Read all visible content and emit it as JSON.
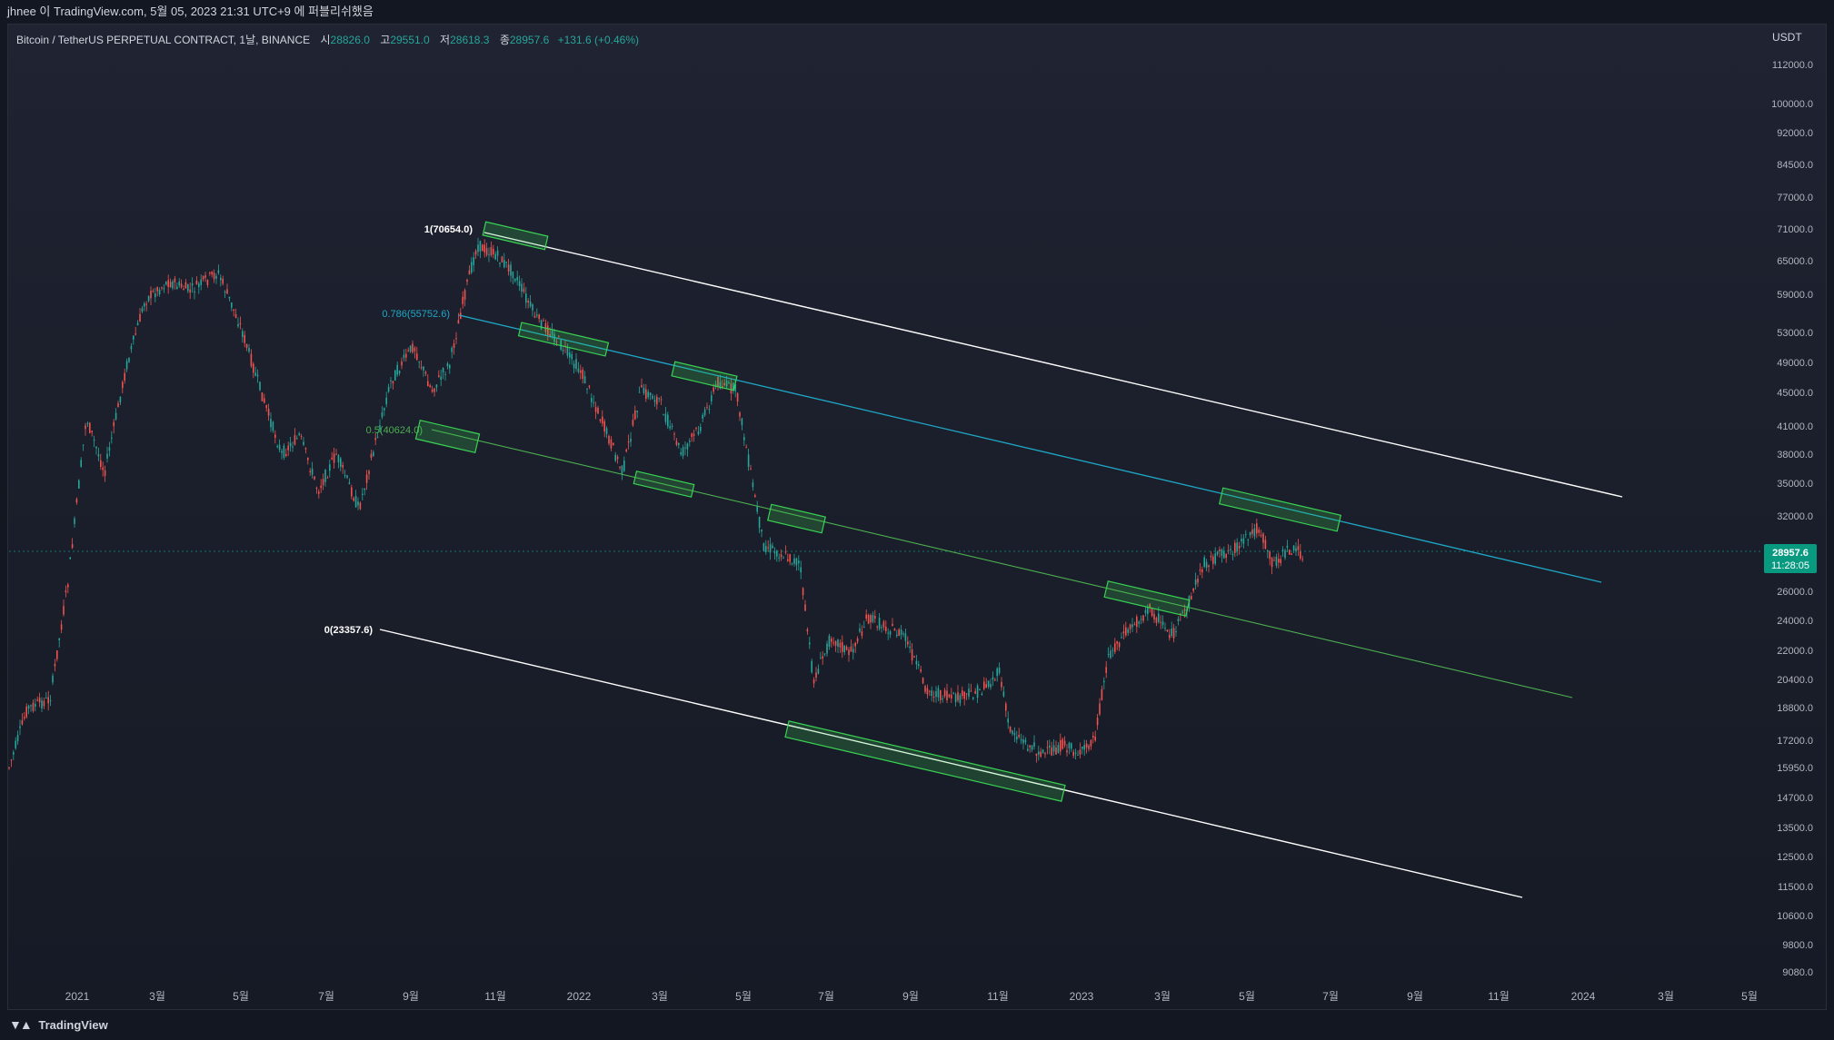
{
  "header": {
    "title": "jhnee 이 TradingView.com, 5월 05, 2023 21:31 UTC+9 에 퍼블리쉬했음"
  },
  "legend": {
    "symbol": "Bitcoin / TetherUS PERPETUAL CONTRACT, 1날, BINANCE",
    "open_label": "시",
    "open": "28826.0",
    "high_label": "고",
    "high": "29551.0",
    "low_label": "저",
    "low": "28618.3",
    "close_label": "종",
    "close": "28957.6",
    "change": "+131.6 (+0.46%)"
  },
  "price_axis": {
    "currency": "USDT",
    "ticks": [
      "112000.0",
      "100000.0",
      "92000.0",
      "84500.0",
      "77000.0",
      "71000.0",
      "65000.0",
      "59000.0",
      "53000.0",
      "49000.0",
      "45000.0",
      "41000.0",
      "38000.0",
      "35000.0",
      "32000.0",
      "26000.0",
      "24000.0",
      "22000.0",
      "20400.0",
      "18800.0",
      "17200.0",
      "15950.0",
      "14700.0",
      "13500.0",
      "12500.0",
      "11500.0",
      "10600.0",
      "9800.0",
      "9080.0"
    ],
    "current_price": "28957.6",
    "countdown": "11:28:05"
  },
  "time_axis": {
    "ticks": [
      "2021",
      "3월",
      "5월",
      "7월",
      "9월",
      "11월",
      "2022",
      "3월",
      "5월",
      "7월",
      "9월",
      "11월",
      "2023",
      "3월",
      "5월",
      "7월",
      "9월",
      "11월",
      "2024",
      "3월",
      "5월"
    ]
  },
  "fib_channel": {
    "levels": [
      {
        "label": "1(70654.0)",
        "color": "#ffffff"
      },
      {
        "label": "0.786(55752.6)",
        "color": "#00bcd4"
      },
      {
        "label": "0.5(40624.0)",
        "color": "#4caf50"
      },
      {
        "label": "0(23357.6)",
        "color": "#ffffff"
      }
    ]
  },
  "colors": {
    "up": "#26a69a",
    "down": "#ef5350",
    "highlight_box": "#39d353",
    "price_badge": "#089981"
  },
  "footer": {
    "brand": "TradingView",
    "logo_icon": "tradingview-logo-icon"
  }
}
